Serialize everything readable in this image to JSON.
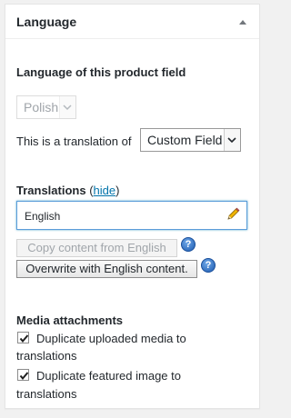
{
  "panel": {
    "title": "Language",
    "toggle_icon": "triangle-up-icon"
  },
  "language_section": {
    "heading": "Language of this product field",
    "language_select": {
      "value": "Polish",
      "disabled": true
    },
    "translation_of_label": "This is a translation of",
    "translation_of_select": {
      "value": "Custom Field"
    }
  },
  "translations": {
    "heading": "Translations",
    "paren_open": "(",
    "hide_link": "hide",
    "paren_close": ")",
    "english_field": {
      "value": "English",
      "icon": "pencil-icon"
    },
    "copy_button": {
      "label": "Copy content from English",
      "disabled": true
    },
    "overwrite_button": {
      "label": "Overwrite with English content."
    },
    "help_glyph": "?"
  },
  "media": {
    "heading": "Media attachments",
    "options": [
      {
        "label_line1": "Duplicate uploaded media to",
        "label_line2": "translations",
        "checked": true
      },
      {
        "label_line1": "Duplicate featured image to",
        "label_line2": "translations",
        "checked": true
      }
    ]
  },
  "colors": {
    "link": "#0073aa",
    "help_icon": "#1c5ab0",
    "input_focus_border": "#5b9dd9"
  }
}
